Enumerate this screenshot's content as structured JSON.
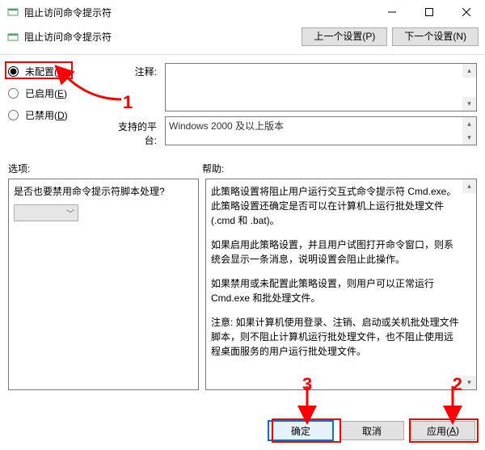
{
  "window": {
    "title": "阻止访问命令提示符",
    "header_label": "阻止访问命令提示符"
  },
  "nav": {
    "prev": "上一个设置(P)",
    "next": "下一个设置(N)"
  },
  "radios": {
    "not_configured": "未配置(",
    "not_configured_key": "C",
    "not_configured_suffix": ")",
    "enabled": "已启用(",
    "enabled_key": "E",
    "enabled_suffix": ")",
    "disabled": "已禁用(",
    "disabled_key": "D",
    "disabled_suffix": ")"
  },
  "labels": {
    "comment": "注释:",
    "platform": "支持的平台:",
    "options": "选项:",
    "help": "帮助:"
  },
  "platform_text": "Windows 2000 及以上版本",
  "options_question": "是否也要禁用命令提示符脚本处理?",
  "help_paragraphs": {
    "p1": "此策略设置将阻止用户运行交互式命令提示符 Cmd.exe。此策略设置还确定是否可以在计算机上运行批处理文件(.cmd 和 .bat)。",
    "p2": "如果启用此策略设置，并且用户试图打开命令窗口，则系统会显示一条消息，说明设置会阻止此操作。",
    "p3": "如果禁用或未配置此策略设置，则用户可以正常运行 Cmd.exe 和批处理文件。",
    "p4": "注意: 如果计算机使用登录、注销、启动或关机批处理文件脚本，则不阻止计算机运行批处理文件，也不阻止使用远程桌面服务的用户运行批处理文件。"
  },
  "buttons": {
    "ok": "确定",
    "cancel": "取消",
    "apply": "应用(",
    "apply_key": "A",
    "apply_suffix": ")"
  },
  "annotations": {
    "a1": "1",
    "a2": "2",
    "a3": "3"
  }
}
